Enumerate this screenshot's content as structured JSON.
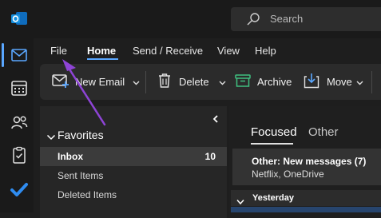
{
  "search": {
    "placeholder": "Search"
  },
  "menu": {
    "items": [
      {
        "label": "File"
      },
      {
        "label": "Home",
        "active": true
      },
      {
        "label": "Send / Receive"
      },
      {
        "label": "View"
      },
      {
        "label": "Help"
      }
    ]
  },
  "ribbon": {
    "new_email": "New Email",
    "delete": "Delete",
    "archive": "Archive",
    "move": "Move"
  },
  "rail": {
    "icons": [
      "outlook-logo-icon",
      "mail-icon",
      "calendar-icon",
      "people-icon",
      "tasks-icon",
      "todo-icon"
    ]
  },
  "folders": {
    "group_label": "Favorites",
    "items": [
      {
        "label": "Inbox",
        "count": "10",
        "selected": true
      },
      {
        "label": "Sent Items",
        "count": ""
      },
      {
        "label": "Deleted Items",
        "count": ""
      }
    ]
  },
  "messages": {
    "tabs": [
      {
        "label": "Focused",
        "active": true
      },
      {
        "label": "Other"
      }
    ],
    "other_notice": {
      "title": "Other: New messages (7)",
      "senders": "Netflix, OneDrive"
    },
    "group_label": "Yesterday"
  },
  "colors": {
    "accent": "#5aa7ff",
    "annotation_arrow": "#8e44d6",
    "background": "#1e1e1e"
  }
}
